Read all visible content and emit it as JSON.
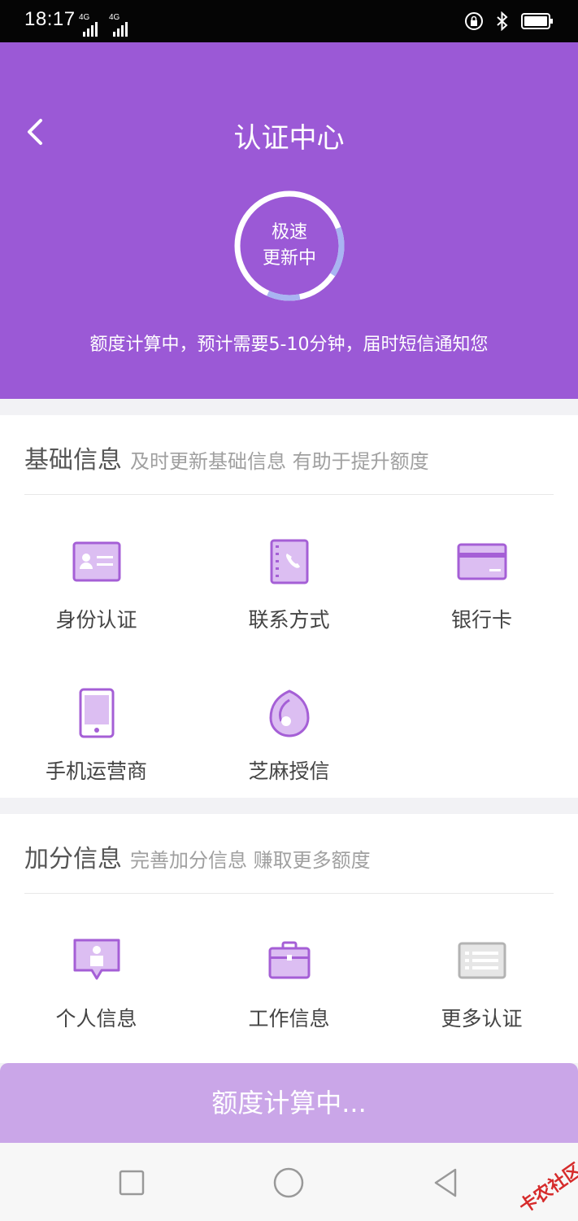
{
  "status_bar": {
    "time": "18:17",
    "signal1": "4G",
    "signal2": "4G"
  },
  "header": {
    "title": "认证中心",
    "ring_line1": "极速",
    "ring_line2": "更新中",
    "notice": "额度计算中，预计需要5-10分钟，届时短信通知您"
  },
  "basic_section": {
    "title": "基础信息",
    "subtitle": "及时更新基础信息 有助于提升额度",
    "items": [
      {
        "label": "身份认证",
        "icon": "id-card-icon"
      },
      {
        "label": "联系方式",
        "icon": "contact-book-icon"
      },
      {
        "label": "银行卡",
        "icon": "bank-card-icon"
      },
      {
        "label": "手机运营商",
        "icon": "mobile-phone-icon"
      },
      {
        "label": "芝麻授信",
        "icon": "sesame-icon"
      }
    ]
  },
  "bonus_section": {
    "title": "加分信息",
    "subtitle": "完善加分信息 赚取更多额度",
    "items": [
      {
        "label": "个人信息",
        "icon": "person-info-icon"
      },
      {
        "label": "工作信息",
        "icon": "briefcase-icon"
      },
      {
        "label": "更多认证",
        "icon": "more-list-icon"
      }
    ]
  },
  "bottom_button": {
    "label": "额度计算中..."
  },
  "watermark": "卡农社区",
  "colors": {
    "primary": "#9b59d6",
    "icon_purple": "#a55fd6",
    "icon_fill": "#dcbef2",
    "disabled_button": "#caa6e8",
    "gray_icon": "#b3b3b3"
  }
}
